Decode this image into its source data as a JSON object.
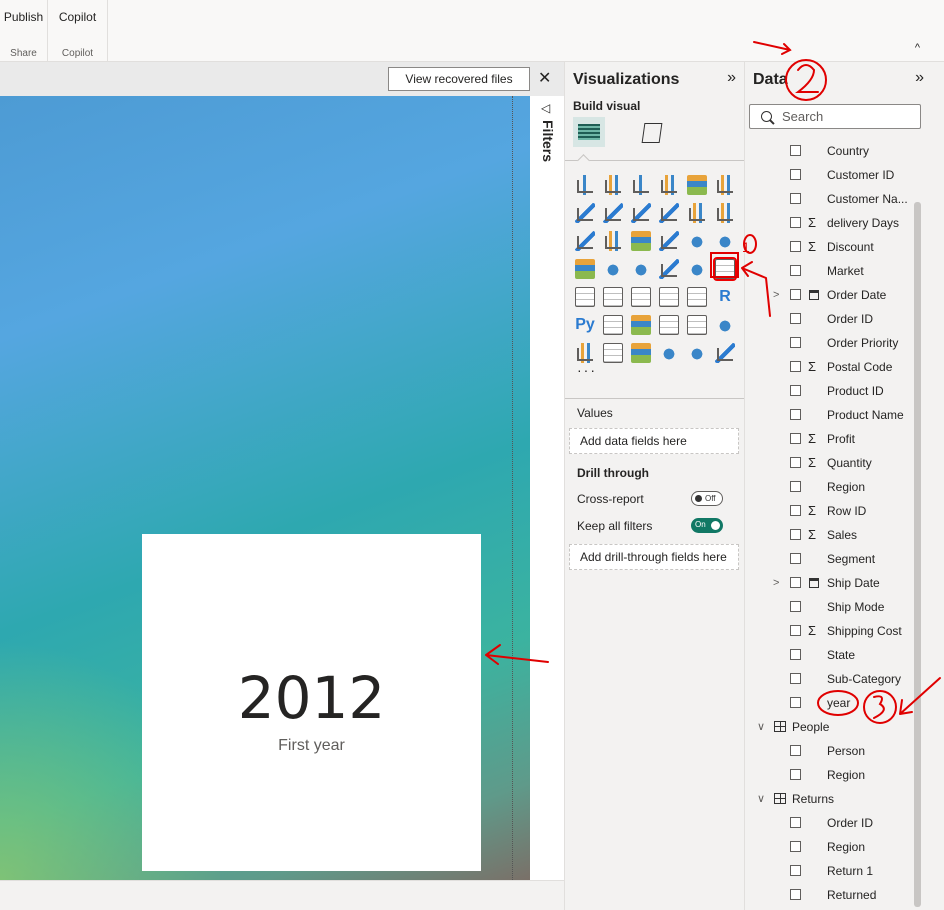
{
  "ribbon": {
    "groups": [
      {
        "button": "Publish",
        "label": "Share"
      },
      {
        "button": "Copilot",
        "label": "Copilot"
      }
    ],
    "collapse_glyph": "^"
  },
  "canvas": {
    "recover_button": "View recovered files",
    "close_glyph": "✕",
    "filters_label": "Filters",
    "card": {
      "value": "2012",
      "label": "First year"
    }
  },
  "visualizations": {
    "title": "Visualizations",
    "expand_glyph": "»",
    "build_visual": "Build visual",
    "icons": [
      "stacked-bar-icon",
      "stacked-column-icon",
      "clustered-bar-icon",
      "clustered-column-icon",
      "100-bar-icon",
      "100-column-icon",
      "line-chart-icon",
      "area-chart-icon",
      "stacked-area-icon",
      "100-area-icon",
      "line-column-icon",
      "line-clustered-icon",
      "ribbon-chart-icon",
      "waterfall-icon",
      "funnel-icon",
      "scatter-icon",
      "pie-chart-icon",
      "donut-chart-icon",
      "treemap-icon",
      "map-icon",
      "filled-map-icon",
      "azure-map-icon",
      "gauge-icon",
      "card-icon",
      "multi-row-card-icon",
      "kpi-icon",
      "slicer-icon",
      "table-icon",
      "matrix-icon",
      "r-visual-icon",
      "python-visual-icon",
      "key-influencers-icon",
      "decomposition-tree-icon",
      "qa-icon",
      "narrative-icon",
      "goals-icon",
      "paginated-report-icon",
      "power-apps-icon",
      "power-automate-icon",
      "new-visual-icon",
      "diamond-icon",
      "arrow-icon"
    ],
    "r_label": "R",
    "py_label": "Py",
    "more": "···",
    "values_label": "Values",
    "values_placeholder": "Add data fields here",
    "drill_label": "Drill through",
    "cross_report_label": "Cross-report",
    "cross_report_state": "Off",
    "keep_filters_label": "Keep all filters",
    "keep_filters_state": "On",
    "drill_placeholder": "Add drill-through fields here"
  },
  "data": {
    "title": "Data",
    "expand_glyph": "»",
    "search_placeholder": "Search",
    "fields": [
      {
        "name": "Country",
        "type": "text"
      },
      {
        "name": "Customer ID",
        "type": "text"
      },
      {
        "name": "Customer Na...",
        "type": "text"
      },
      {
        "name": "delivery Days",
        "type": "sum"
      },
      {
        "name": "Discount",
        "type": "sum"
      },
      {
        "name": "Market",
        "type": "text"
      },
      {
        "name": "Order Date",
        "type": "date"
      },
      {
        "name": "Order ID",
        "type": "text"
      },
      {
        "name": "Order Priority",
        "type": "text"
      },
      {
        "name": "Postal Code",
        "type": "sum"
      },
      {
        "name": "Product ID",
        "type": "text"
      },
      {
        "name": "Product Name",
        "type": "text"
      },
      {
        "name": "Profit",
        "type": "sum"
      },
      {
        "name": "Quantity",
        "type": "sum"
      },
      {
        "name": "Region",
        "type": "text"
      },
      {
        "name": "Row ID",
        "type": "sum"
      },
      {
        "name": "Sales",
        "type": "sum"
      },
      {
        "name": "Segment",
        "type": "text"
      },
      {
        "name": "Ship Date",
        "type": "date"
      },
      {
        "name": "Ship Mode",
        "type": "text"
      },
      {
        "name": "Shipping Cost",
        "type": "sum"
      },
      {
        "name": "State",
        "type": "text"
      },
      {
        "name": "Sub-Category",
        "type": "text"
      },
      {
        "name": "year",
        "type": "text"
      }
    ],
    "tables": [
      {
        "name": "People",
        "fields": [
          "Person",
          "Region"
        ]
      },
      {
        "name": "Returns",
        "fields": [
          "Order ID",
          "Region",
          "Return 1",
          "Returned"
        ]
      }
    ]
  },
  "annotations": {
    "color": "#e00000",
    "numbers": [
      "1",
      "2",
      "3"
    ]
  }
}
